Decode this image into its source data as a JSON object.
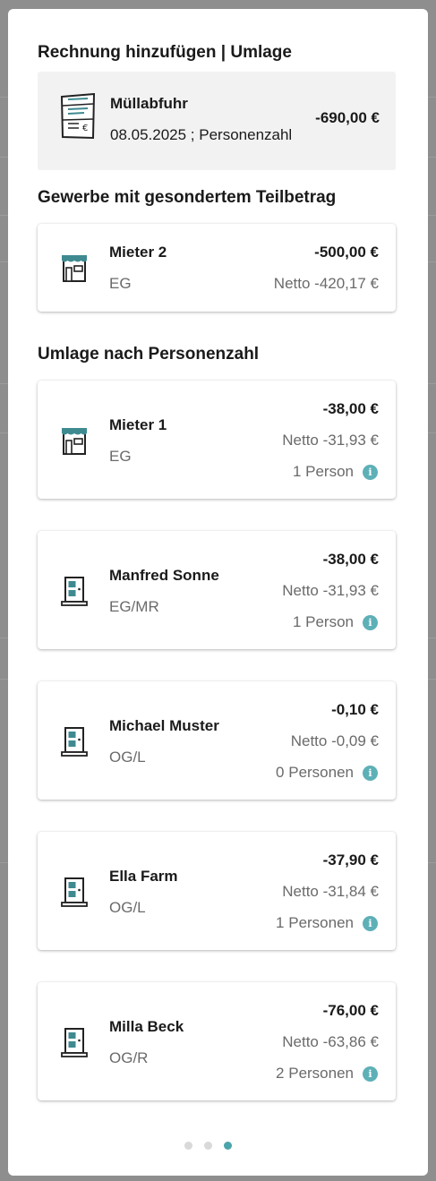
{
  "title": "Rechnung hinzufügen | Umlage",
  "invoice": {
    "name": "Müllabfuhr",
    "subtitle": "08.05.2025 ; Personenzahl",
    "amount": "-690,00 €",
    "icon": "invoice-icon"
  },
  "sections": {
    "commercial": "Gewerbe mit gesondertem Teilbetrag",
    "per_person": "Umlage nach Personenzahl"
  },
  "commercial_card": {
    "name": "Mieter 2",
    "unit": "EG",
    "amount": "-500,00 €",
    "netto": "Netto -420,17 €",
    "icon": "shop-icon"
  },
  "tenants": [
    {
      "name": "Mieter 1",
      "unit": "EG",
      "amount": "-38,00 €",
      "netto": "Netto -31,93 €",
      "persons": "1 Person",
      "icon": "shop-icon"
    },
    {
      "name": "Manfred Sonne",
      "unit": "EG/MR",
      "amount": "-38,00 €",
      "netto": "Netto -31,93 €",
      "persons": "1 Person",
      "icon": "door-icon"
    },
    {
      "name": "Michael Muster",
      "unit": "OG/L",
      "amount": "-0,10 €",
      "netto": "Netto -0,09 €",
      "persons": "0 Personen",
      "icon": "door-icon"
    },
    {
      "name": "Ella Farm",
      "unit": "OG/L",
      "amount": "-37,90 €",
      "netto": "Netto -31,84 €",
      "persons": "1 Personen",
      "icon": "door-icon"
    },
    {
      "name": "Milla Beck",
      "unit": "OG/R",
      "amount": "-76,00 €",
      "netto": "Netto -63,86 €",
      "persons": "2 Personen",
      "icon": "door-icon"
    }
  ],
  "pagination": {
    "pages": 3,
    "active": 3
  },
  "colors": {
    "accent": "#5eb0b7",
    "icon_teal": "#3f8a91"
  }
}
